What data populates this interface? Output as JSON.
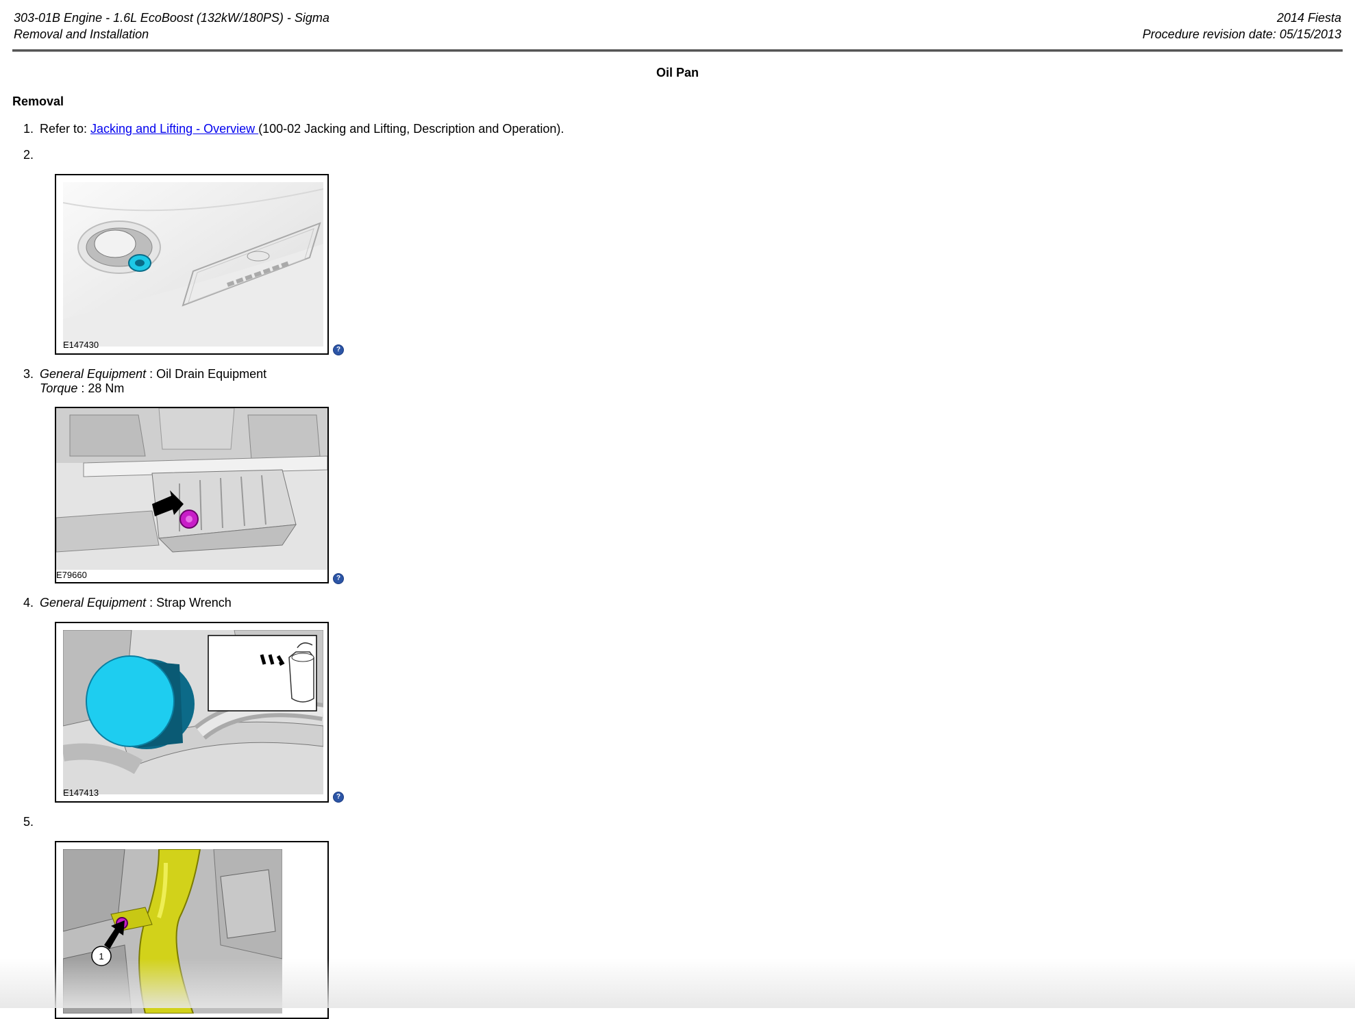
{
  "header": {
    "left_line1": "303-01B Engine - 1.6L EcoBoost (132kW/180PS) - Sigma",
    "left_line2": "Removal and Installation",
    "right_line1": "2014 Fiesta",
    "right_line2": "Procedure revision date: 05/15/2013"
  },
  "title": "Oil Pan",
  "section": "Removal",
  "steps": [
    {
      "num": "1.",
      "prefix": "Refer to: ",
      "link": "Jacking and Lifting - Overview ",
      "suffix": "(100-02 Jacking and Lifting, Description and Operation)."
    },
    {
      "num": "2.",
      "figure_id": "E147430"
    },
    {
      "num": "3.",
      "label1": "General Equipment",
      "value1": " : Oil Drain Equipment",
      "label2": "Torque",
      "value2": " : 28 Nm",
      "figure_id": "E79660"
    },
    {
      "num": "4.",
      "label1": "General Equipment",
      "value1": " : Strap Wrench",
      "figure_id": "E147413"
    },
    {
      "num": "5.",
      "callout": "1"
    }
  ],
  "help_glyph": "?",
  "icons": [
    "help-icon"
  ],
  "colors": {
    "link": "#0000ee",
    "help": "#2c55a6",
    "highlight_magenta": "#c81ec8",
    "highlight_cyan": "#1ec8e6",
    "highlight_yellow": "#d4d400"
  }
}
